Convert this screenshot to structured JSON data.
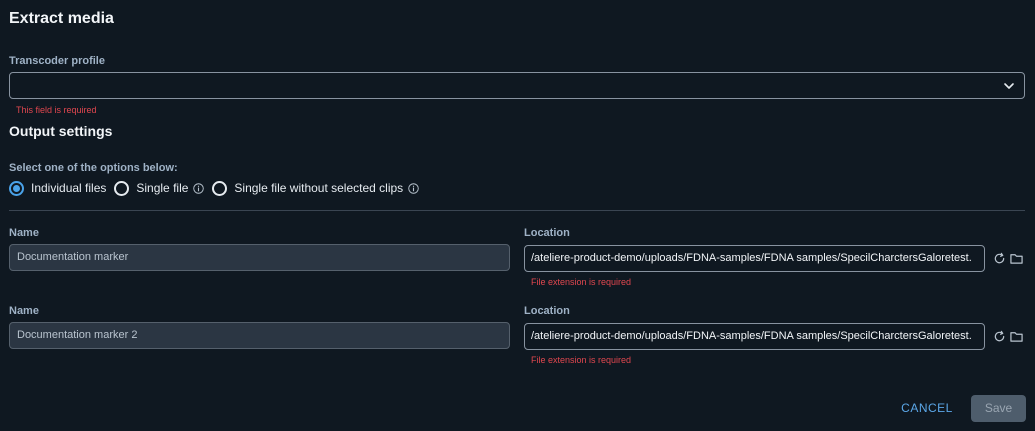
{
  "page": {
    "title": "Extract media"
  },
  "transcoder": {
    "label": "Transcoder profile",
    "value": "",
    "error": "This field is required"
  },
  "output": {
    "section_title": "Output settings",
    "prompt": "Select one of the options below:",
    "options": [
      {
        "label": "Individual files",
        "checked": true,
        "info": false
      },
      {
        "label": "Single file",
        "checked": false,
        "info": true
      },
      {
        "label": "Single file without selected clips",
        "checked": false,
        "info": true
      }
    ]
  },
  "rows": [
    {
      "name_label": "Name",
      "name_value": "Documentation marker",
      "location_label": "Location",
      "location_value": "/ateliere-product-demo/uploads/FDNA-samples/FDNA samples/SpecilCharctersGaloretest.",
      "location_error": "File extension is required"
    },
    {
      "name_label": "Name",
      "name_value": "Documentation marker 2",
      "location_label": "Location",
      "location_value": "/ateliere-product-demo/uploads/FDNA-samples/FDNA samples/SpecilCharctersGaloretest.",
      "location_error": "File extension is required"
    }
  ],
  "actions": {
    "cancel_label": "CANCEL",
    "save_label": "Save"
  },
  "icons": {
    "dropdown": "chevron-down-icon",
    "info": "info-icon",
    "refresh": "refresh-icon",
    "folder": "folder-icon"
  },
  "colors": {
    "background": "#0f1821",
    "accent": "#4aa3ea",
    "error": "#e0474f"
  }
}
